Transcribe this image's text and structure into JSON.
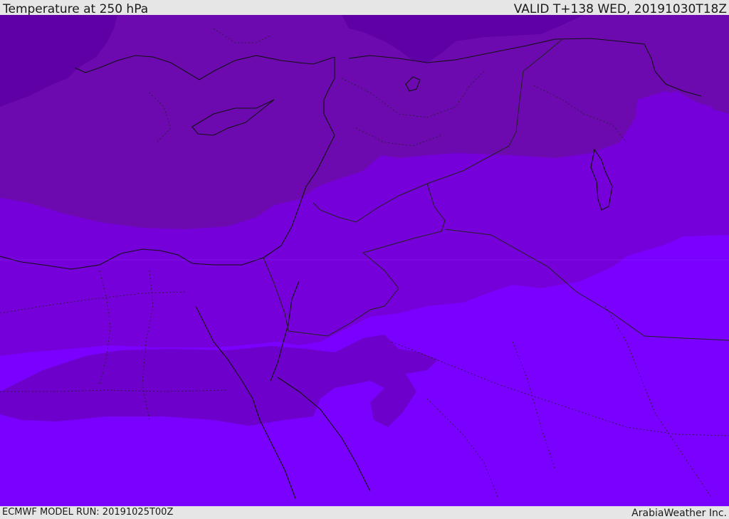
{
  "header": {
    "title": "Temperature at 250 hPa",
    "valid_time": "VALID T+138 WED, 20191030T18Z"
  },
  "footer": {
    "model_run": "ECMWF MODEL RUN: 20191025T00Z",
    "credit": "ArabiaWeather Inc."
  },
  "colors": {
    "band_coldest": "#5e00a6",
    "band_cold": "#6c0ab0",
    "band_mid": "#7600d9",
    "band_warm": "#6e00cc",
    "band_warmest": "#7a00ff",
    "coastline": "#111111",
    "border": "#222222"
  }
}
